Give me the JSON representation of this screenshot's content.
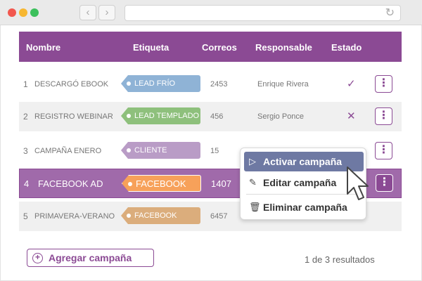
{
  "browser": {
    "back": "‹",
    "forward": "›",
    "reload": "↻"
  },
  "table": {
    "headers": {
      "name": "Nombre",
      "tag": "Etiqueta",
      "mails": "Correos",
      "owner": "Responsable",
      "state": "Estado"
    },
    "rows": [
      {
        "idx": "1",
        "name": "DESCARGÓ EBOOK",
        "tag": "LEAD FRÍO",
        "tag_color": "#8fb3d6",
        "mails": "2453",
        "owner": "Enrique Rivera",
        "state": "✓"
      },
      {
        "idx": "2",
        "name": "REGISTRO WEBINAR",
        "tag": "LEAD TEMPLADO",
        "tag_color": "#8ec07c",
        "mails": "456",
        "owner": "Sergio Ponce",
        "state": "✕"
      },
      {
        "idx": "3",
        "name": "CAMPAÑA ENERO",
        "tag": "CLIENTE",
        "tag_color": "#b99cc6",
        "mails": "15",
        "owner": "",
        "state": ""
      },
      {
        "idx": "4",
        "name": "FACEBOOK AD",
        "tag": "FACEBOOK",
        "tag_color": "#f7a15a",
        "mails": "1407",
        "owner": "",
        "state": ""
      },
      {
        "idx": "5",
        "name": "PRIMAVERA-VERANO",
        "tag": "FACEBOOK",
        "tag_color": "#dbad7c",
        "mails": "6457",
        "owner": "",
        "state": ""
      }
    ],
    "kebab": "⋮"
  },
  "menu": {
    "activate": "Activar campaña",
    "edit": "Editar campaña",
    "delete": "Eliminar campaña",
    "icons": {
      "activate": "play-icon",
      "edit": "edit-icon",
      "delete": "trash-icon"
    }
  },
  "footer": {
    "add_label": "Agregar campaña",
    "add_icon": "⊕",
    "results": "1 de 3 resultados"
  },
  "colors": {
    "accent": "#8b4a94",
    "active_row": "#a06aaa",
    "menu_highlight": "#6e79a3"
  }
}
